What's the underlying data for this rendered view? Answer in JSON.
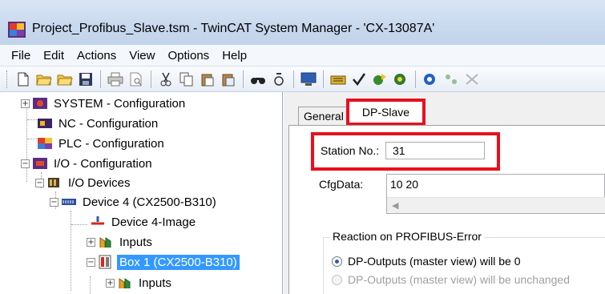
{
  "window": {
    "title": "Project_Profibus_Slave.tsm - TwinCAT System Manager - 'CX-13087A'",
    "app_icon": "twincat-app-icon"
  },
  "menu": {
    "items": [
      "File",
      "Edit",
      "Actions",
      "View",
      "Options",
      "Help"
    ]
  },
  "toolbar": {
    "buttons": [
      "new-icon",
      "open-icon",
      "open-folder-icon",
      "save-icon",
      "print-icon",
      "print-preview-icon",
      "cut-icon",
      "copy-icon",
      "paste-icon",
      "paste-with-links-icon",
      "find-icon",
      "find-next-icon",
      "config-mode-icon",
      "activate-config-icon",
      "check-config-icon",
      "set-run-mode-icon",
      "scan-devices-icon",
      "online-icon",
      "toggle-free-run-icon",
      "more-icon"
    ]
  },
  "tree": {
    "items": [
      {
        "label": "SYSTEM - Configuration",
        "icon": "system-config-icon",
        "expander": "+"
      },
      {
        "label": "NC - Configuration",
        "icon": "nc-config-icon",
        "expander": ""
      },
      {
        "label": "PLC - Configuration",
        "icon": "plc-config-icon",
        "expander": ""
      },
      {
        "label": "I/O - Configuration",
        "icon": "io-config-icon",
        "expander": "−"
      },
      {
        "label": "I/O Devices",
        "icon": "io-devices-icon",
        "expander": "−"
      },
      {
        "label": "Device 4 (CX2500-B310)",
        "icon": "device-icon",
        "expander": "−"
      },
      {
        "label": "Device 4-Image",
        "icon": "device-image-icon",
        "expander": ""
      },
      {
        "label": "Inputs",
        "icon": "inputs-icon",
        "expander": "+"
      },
      {
        "label": "Box 1 (CX2500-B310)",
        "icon": "box-icon",
        "expander": "−",
        "selected": true
      },
      {
        "label": "Inputs",
        "icon": "inputs-icon",
        "expander": "+"
      }
    ]
  },
  "tabs": {
    "general": "General",
    "dp_slave": "DP-Slave"
  },
  "dp_slave": {
    "station_label": "Station No.:",
    "station_value": "31",
    "cfg_label": "CfgData:",
    "cfg_value": "10 20",
    "reaction_group_title": "Reaction on PROFIBUS-Error",
    "option_zero": "DP-Outputs (master view) will be 0",
    "option_unchanged": "DP-Outputs (master view) will be unchanged"
  },
  "colors": {
    "highlight_red": "#e8101f",
    "selection_blue": "#3399ff"
  }
}
